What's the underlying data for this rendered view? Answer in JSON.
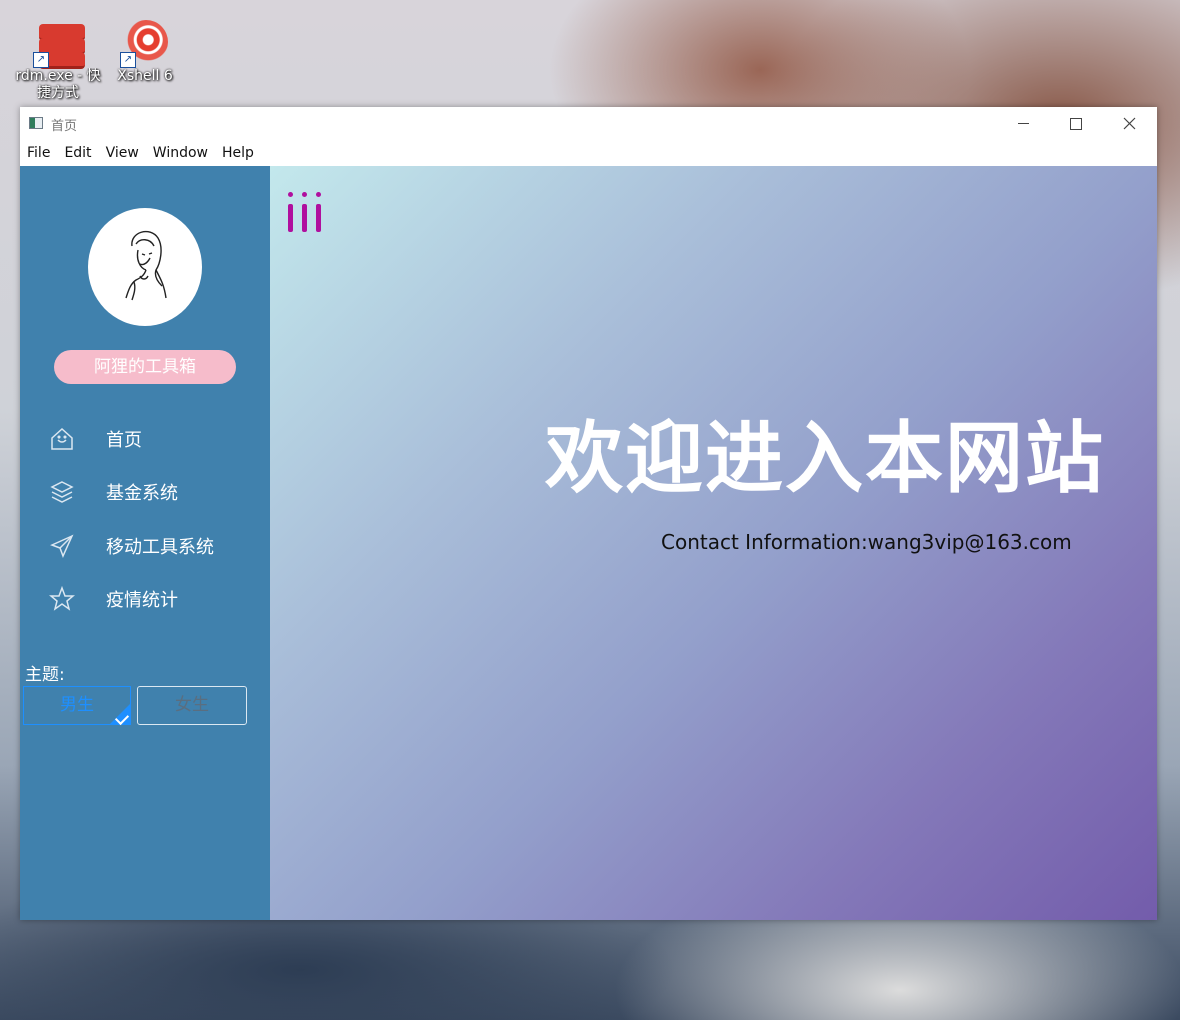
{
  "desktop": {
    "icons": [
      {
        "label": "rdm.exe - 快捷方式",
        "icon": "redis-icon"
      },
      {
        "label": "Xshell 6",
        "icon": "xshell-icon"
      }
    ]
  },
  "window": {
    "title": "首页",
    "menu": [
      "File",
      "Edit",
      "View",
      "Window",
      "Help"
    ]
  },
  "sidebar": {
    "brand_label": "阿狸的工具箱",
    "nav_items": [
      {
        "label": "首页",
        "icon": "home-icon"
      },
      {
        "label": "基金系统",
        "icon": "layers-icon"
      },
      {
        "label": "移动工具系统",
        "icon": "send-icon"
      },
      {
        "label": "疫情统计",
        "icon": "star-icon"
      }
    ],
    "theme": {
      "label": "主题:",
      "options": [
        "男生",
        "女生"
      ],
      "selected": "男生"
    }
  },
  "main": {
    "welcome_title": "欢迎进入本网站",
    "contact": "Contact Information:wang3vip@163.com"
  },
  "colors": {
    "sidebar_bg": "#4081ad",
    "pill_bg": "#f6bccb",
    "accent": "#1e8fff",
    "toggle_icon": "#b00f9e"
  }
}
